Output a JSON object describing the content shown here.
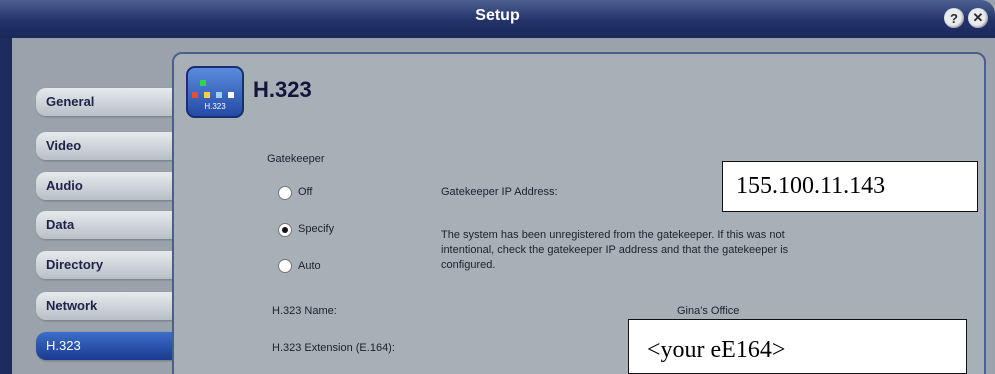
{
  "window": {
    "title": "Setup"
  },
  "titlebar": {
    "help_icon": "question-icon",
    "help_glyph": "?",
    "close_icon": "close-icon",
    "close_glyph": "✕"
  },
  "sidebar": {
    "items": [
      {
        "label": "General",
        "active": false
      },
      {
        "label": "Video",
        "active": false
      },
      {
        "label": "Audio",
        "active": false
      },
      {
        "label": "Data",
        "active": false
      },
      {
        "label": "Directory",
        "active": false
      },
      {
        "label": "Network",
        "active": false
      },
      {
        "label": "H.323",
        "active": true
      }
    ]
  },
  "page": {
    "icon": {
      "name": "h323-icon",
      "text": "H.323"
    },
    "heading": "H.323"
  },
  "gatekeeper": {
    "section_label": "Gatekeeper",
    "options": [
      {
        "label": "Off",
        "checked": false
      },
      {
        "label": "Specify",
        "checked": true
      },
      {
        "label": "Auto",
        "checked": false
      }
    ],
    "ip_label": "Gatekeeper IP Address:",
    "message_lines": [
      "The system has been unregistered from the gatekeeper. If this was not",
      "intentional, check the gatekeeper IP address and that the gatekeeper is",
      "configured."
    ]
  },
  "h323": {
    "name_label": "H.323 Name:",
    "name_value": "Gina's Office",
    "extension_label": "H.323 Extension (E.164):"
  },
  "callouts": {
    "ip_address": "155.100.11.143",
    "extension": "<your  eE164>"
  }
}
